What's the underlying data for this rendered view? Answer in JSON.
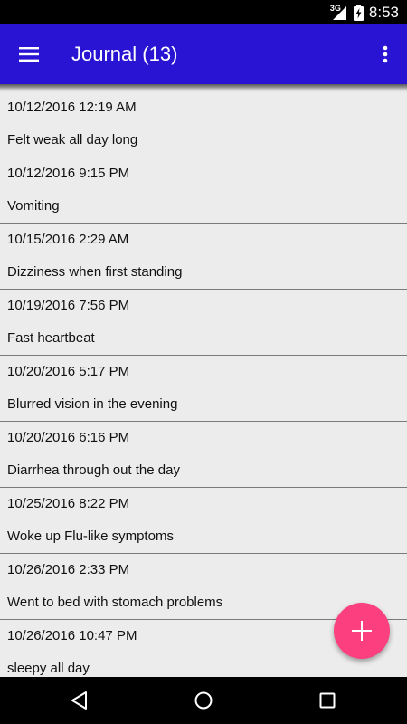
{
  "status_bar": {
    "network_type": "3G",
    "time": "8:53",
    "icons": [
      "signal-icon",
      "battery-charging-icon"
    ]
  },
  "app_bar": {
    "title": "Journal (13)",
    "color": "#2814d2",
    "icons": [
      "menu-icon",
      "more-vert-icon"
    ]
  },
  "entries": [
    {
      "date": "10/12/2016 12:19 AM",
      "text": "Felt weak all day long"
    },
    {
      "date": "10/12/2016 9:15 PM",
      "text": "Vomiting"
    },
    {
      "date": "10/15/2016 2:29 AM",
      "text": "Dizziness when first standing"
    },
    {
      "date": "10/19/2016 7:56 PM",
      "text": "Fast heartbeat"
    },
    {
      "date": "10/20/2016 5:17 PM",
      "text": "Blurred vision in the evening"
    },
    {
      "date": "10/20/2016 6:16 PM",
      "text": "Diarrhea through out the day"
    },
    {
      "date": "10/25/2016 8:22 PM",
      "text": "Woke up Flu-like symptoms"
    },
    {
      "date": "10/26/2016 2:33 PM",
      "text": "Went to bed with stomach problems"
    },
    {
      "date": "10/26/2016 10:47 PM",
      "text": "sleepy all day"
    }
  ],
  "fab": {
    "icon": "plus-icon",
    "color": "#fc3f7f"
  },
  "nav_bar": {
    "icons": [
      "back-icon",
      "home-icon",
      "recents-icon"
    ]
  }
}
